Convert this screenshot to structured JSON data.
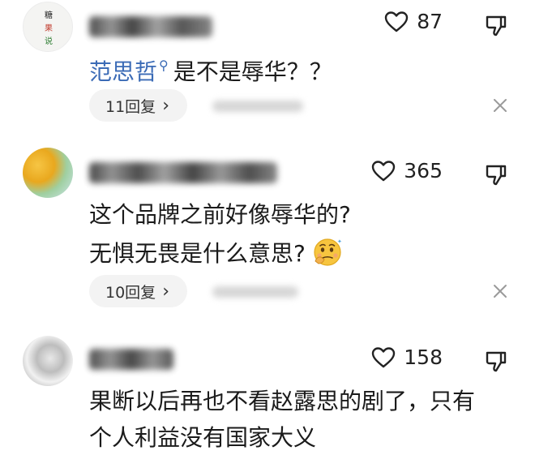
{
  "comments": [
    {
      "avatar_text": "糖果说",
      "likes": "87",
      "mention": "范思哲",
      "text": "是不是辱华？？",
      "replies_label": "11回复",
      "reply_chevron": "›"
    },
    {
      "likes": "365",
      "text_line1": "这个品牌之前好像辱华的?",
      "text_line2": "无惧无畏是什么意思?",
      "replies_label": "10回复",
      "reply_chevron": "›"
    },
    {
      "likes": "158",
      "text_line1": "果断以后再也不看赵露思的剧了，只有",
      "text_line2": "个人利益没有国家大义"
    }
  ],
  "colors": {
    "mention": "#3b6bb6",
    "pill_bg": "#f3f3f3",
    "text": "#1b1b1b"
  },
  "icons": [
    "heart-icon",
    "dislike-icon",
    "close-icon",
    "thinking-emoji-icon"
  ]
}
